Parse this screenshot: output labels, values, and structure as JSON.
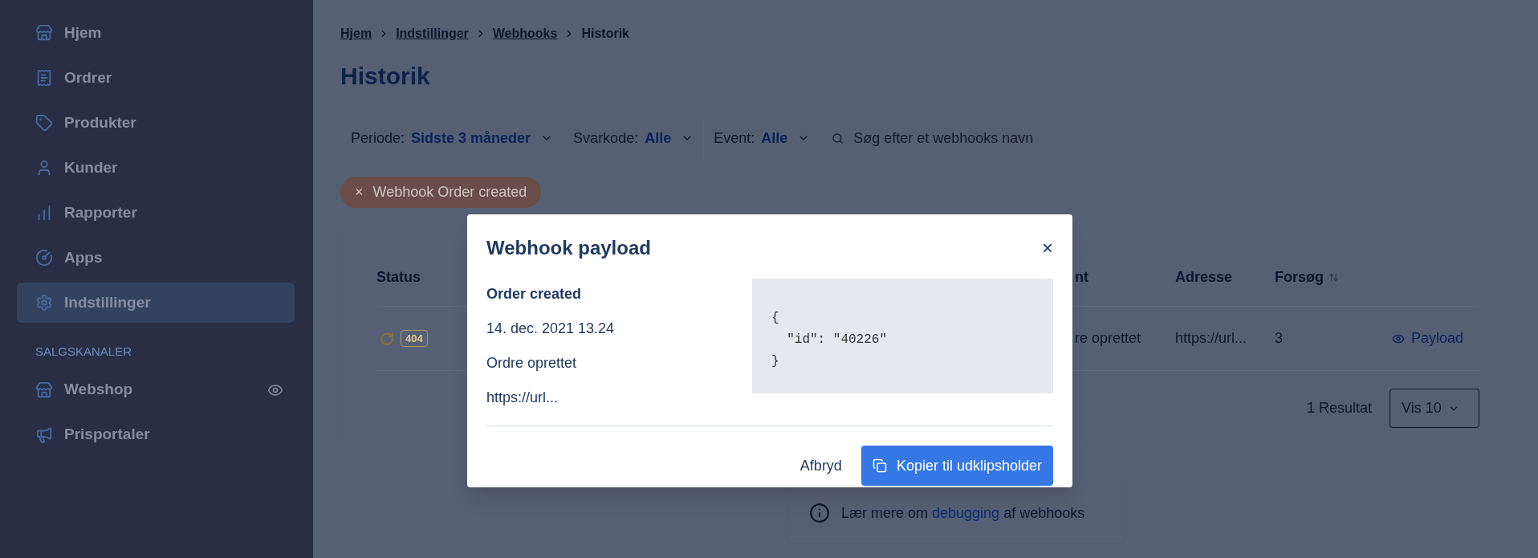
{
  "sidebar": {
    "items": [
      {
        "label": "Hjem",
        "selected": false
      },
      {
        "label": "Ordrer",
        "selected": false
      },
      {
        "label": "Produkter",
        "selected": false
      },
      {
        "label": "Kunder",
        "selected": false
      },
      {
        "label": "Rapporter",
        "selected": false
      },
      {
        "label": "Apps",
        "selected": false
      },
      {
        "label": "Indstillinger",
        "selected": true
      }
    ],
    "section_title": "SALGSKANALER",
    "channels": [
      {
        "label": "Webshop",
        "has_preview": true
      },
      {
        "label": "Prisportaler",
        "has_preview": false
      }
    ]
  },
  "breadcrumb": [
    "Hjem",
    "Indstillinger",
    "Webhooks",
    "Historik"
  ],
  "page_title": "Historik",
  "filters": [
    {
      "label": "Periode:",
      "value": "Sidste 3 måneder"
    },
    {
      "label": "Svarkode:",
      "value": "Alle"
    },
    {
      "label": "Event:",
      "value": "Alle"
    }
  ],
  "search": {
    "placeholder": "Søg efter et webhooks navn"
  },
  "active_filter": {
    "label": "Webhook Order created",
    "remove": "×"
  },
  "table": {
    "columns": [
      "Status",
      "nt",
      "Adresse",
      "Forsøg"
    ],
    "rows": [
      {
        "status_code": "404",
        "event": "re oprettet",
        "address": "https://url...",
        "attempts": "3",
        "action": "Payload"
      }
    ],
    "result_count": "1 Resultat",
    "page_size_label": "Vis",
    "page_size": "10"
  },
  "help": {
    "text_before": "Lær mere om",
    "link": "debugging",
    "text_after": "af webhooks"
  },
  "modal": {
    "title": "Webhook payload",
    "close": "×",
    "event": "Order created",
    "date": "14. dec. 2021 13.24",
    "event_name": "Ordre oprettet",
    "url": "https://url...",
    "payload": "{\n  \"id\": \"40226\"\n}",
    "cancel": "Afbryd",
    "copy": "Kopier til udklipsholder"
  }
}
